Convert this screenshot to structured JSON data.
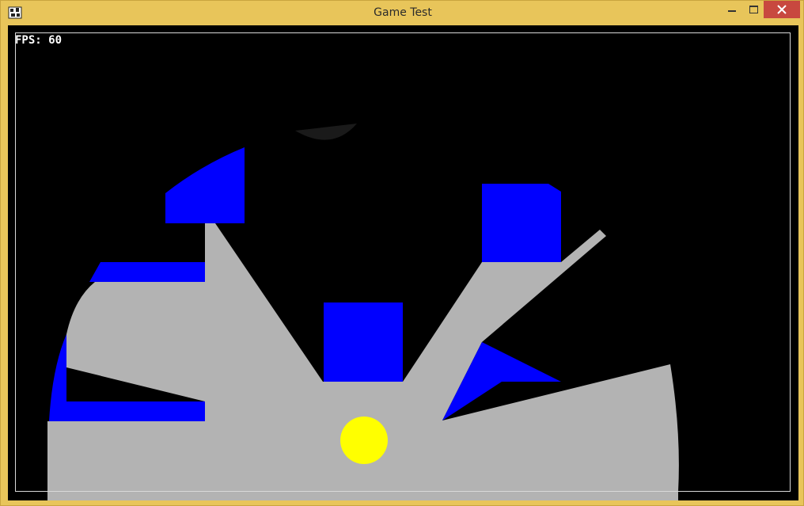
{
  "window": {
    "title": "Game Test",
    "app_icon": "game-app-icon",
    "controls": {
      "minimize_icon": "minimize-icon",
      "maximize_icon": "maximize-icon",
      "close_icon": "close-icon"
    }
  },
  "hud": {
    "fps_label": "FPS:",
    "fps_value": "60",
    "fps_text": "FPS: 60"
  },
  "colors": {
    "frame": "#e8c55a",
    "close_button": "#c8483f",
    "background": "#000000",
    "floor": "#b3b3b3",
    "walls": "#0000ff",
    "player": "#ffff00",
    "shadow": "#1a1a1a"
  }
}
